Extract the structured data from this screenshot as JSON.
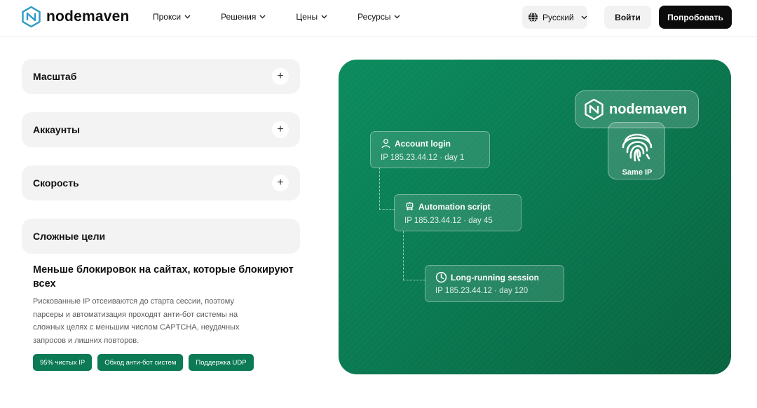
{
  "header": {
    "logo_text": "nodemaven",
    "nav": [
      {
        "label": "Прокси"
      },
      {
        "label": "Решения"
      },
      {
        "label": "Цены"
      },
      {
        "label": "Ресурсы"
      }
    ],
    "language": "Русский",
    "login_label": "Войти",
    "try_label": "Попробовать"
  },
  "accordion": {
    "items": [
      {
        "title": "Масштаб",
        "expanded": false
      },
      {
        "title": "Аккаунты",
        "expanded": false
      },
      {
        "title": "Скорость",
        "expanded": false
      },
      {
        "title": "Сложные цели",
        "expanded": true
      }
    ],
    "open_panel": {
      "heading": "Меньше блокировок на сайтах, которые блокируют всех",
      "body": "Рискованные IP отсеиваются до старта сессии, поэтому парсеры и автоматизация проходят анти-бот системы на сложных целях с меньшим числом CAPTCHA, неудачных запросов и лишних повторов.",
      "tags": [
        "95% чистых IP",
        "Обход анти-бот систем",
        "Поддержка UDP"
      ]
    }
  },
  "visual": {
    "brand_text": "nodemaven",
    "fingerprint_label": "Same IP",
    "cards": [
      {
        "title": "Account login",
        "sub": "IP 185.23.44.12 · day 1",
        "icon": "user-icon"
      },
      {
        "title": "Automation script",
        "sub": "IP 185.23.44.12 · day 45",
        "icon": "robot-icon"
      },
      {
        "title": "Long-running session",
        "sub": "IP 185.23.44.12 · day 120",
        "icon": "clock-icon"
      }
    ]
  },
  "colors": {
    "accent_green": "#0b7a55",
    "dark_button": "#0c0c0c",
    "panel_gray": "#f3f3f3"
  }
}
